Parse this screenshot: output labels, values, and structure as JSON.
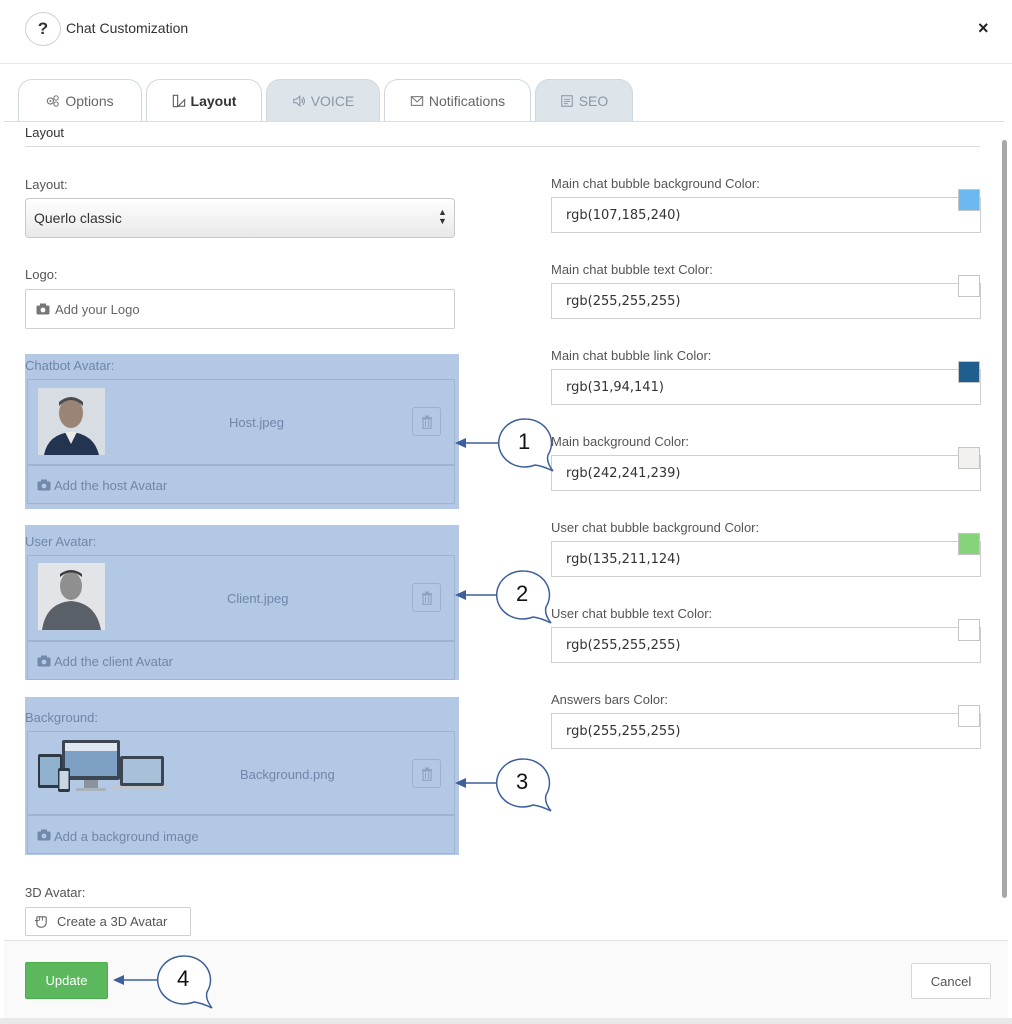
{
  "header": {
    "help_label": "?",
    "title": "Chat Customization",
    "close_label": "×"
  },
  "tabs": [
    {
      "label": "Options",
      "icon": "gears-icon",
      "state": "normal"
    },
    {
      "label": "Layout",
      "icon": "layout-icon",
      "state": "active"
    },
    {
      "label": "VOICE",
      "icon": "speaker-icon",
      "state": "disabled"
    },
    {
      "label": "Notifications",
      "icon": "envelope-icon",
      "state": "normal"
    },
    {
      "label": "SEO",
      "icon": "document-icon",
      "state": "disabled"
    }
  ],
  "section": {
    "title": "Layout"
  },
  "left": {
    "layout_label": "Layout:",
    "layout_value": "Querlo classic",
    "logo_label": "Logo:",
    "logo_placeholder": "Add your Logo",
    "chatbot_avatar": {
      "label": "Chatbot Avatar:",
      "file": "Host.jpeg",
      "add_label": "Add the host Avatar"
    },
    "user_avatar": {
      "label": "User Avatar:",
      "file": "Client.jpeg",
      "add_label": "Add the client Avatar"
    },
    "background": {
      "label": "Background:",
      "file": "Background.png",
      "add_label": "Add a background image"
    },
    "avatar3d_label": "3D Avatar:",
    "avatar3d_button": "Create a 3D Avatar"
  },
  "colors": [
    {
      "label": "Main chat bubble background Color:",
      "value": "rgb(107,185,240)",
      "swatch": "#6bb9f0"
    },
    {
      "label": "Main chat bubble text Color:",
      "value": "rgb(255,255,255)",
      "swatch": "#ffffff"
    },
    {
      "label": "Main chat bubble link Color:",
      "value": "rgb(31,94,141)",
      "swatch": "#1f5e8d"
    },
    {
      "label": "Main background Color:",
      "value": "rgb(242,241,239)",
      "swatch": "#f2f1ef"
    },
    {
      "label": "User chat bubble background Color:",
      "value": "rgb(135,211,124)",
      "swatch": "#87d37c"
    },
    {
      "label": "User chat bubble text Color:",
      "value": "rgb(255,255,255)",
      "swatch": "#ffffff"
    },
    {
      "label": "Answers bars Color:",
      "value": "rgb(255,255,255)",
      "swatch": "#ffffff"
    }
  ],
  "callouts": [
    "1",
    "2",
    "3",
    "4"
  ],
  "footer": {
    "update_label": "Update",
    "cancel_label": "Cancel"
  },
  "theme": {
    "highlight": "#b3c8e4",
    "update_green": "#5cb85c",
    "callout_stroke": "#3d5f9a"
  }
}
